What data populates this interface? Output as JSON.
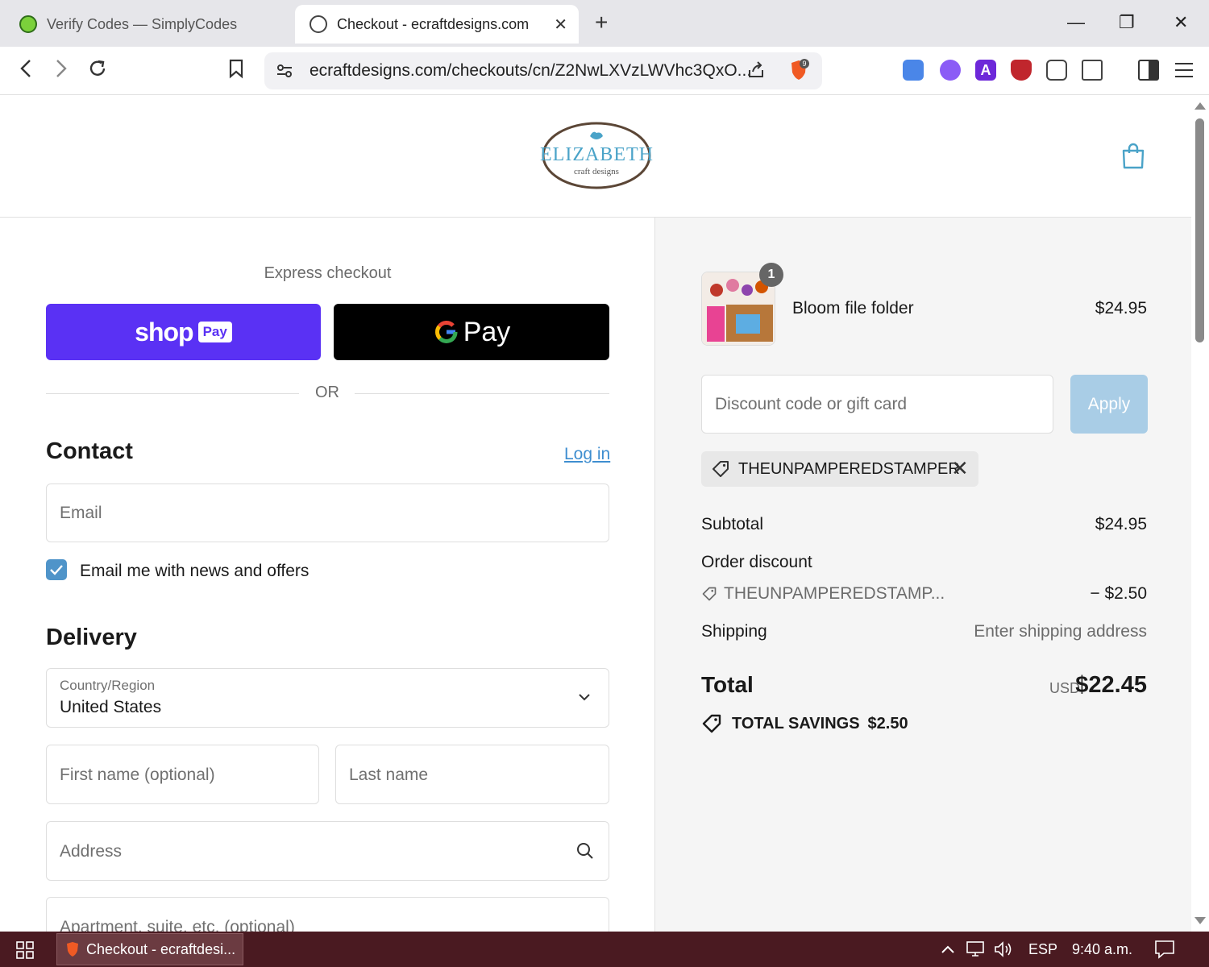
{
  "browser": {
    "tabs": [
      {
        "title": "Verify Codes — SimplyCodes",
        "active": false
      },
      {
        "title": "Checkout - ecraftdesigns.com",
        "active": true
      }
    ],
    "url": "ecraftdesigns.com/checkouts/cn/Z2NwLXVzLWVhc3QxO...",
    "brave_badge": "9"
  },
  "shop": {
    "logo_title": "ELIZABETH",
    "logo_sub": "craft designs"
  },
  "checkout": {
    "express_label": "Express checkout",
    "shoppay_word": "shop",
    "shoppay_chip": "Pay",
    "gpay_label": "Pay",
    "or_label": "OR",
    "contact_title": "Contact",
    "login_label": "Log in",
    "email_placeholder": "Email",
    "newsletter_label": "Email me with news and offers",
    "newsletter_checked": true,
    "delivery_title": "Delivery",
    "country_label": "Country/Region",
    "country_value": "United States",
    "first_name_placeholder": "First name (optional)",
    "last_name_placeholder": "Last name",
    "address_placeholder": "Address",
    "apartment_placeholder": "Apartment, suite, etc. (optional)"
  },
  "summary": {
    "item": {
      "name": "Bloom file folder",
      "price": "$24.95",
      "quantity": "1"
    },
    "discount_placeholder": "Discount code or gift card",
    "apply_label": "Apply",
    "applied_code": "THEUNPAMPEREDSTAMPER",
    "subtotal_label": "Subtotal",
    "subtotal_value": "$24.95",
    "order_discount_label": "Order discount",
    "discount_code_short": "THEUNPAMPEREDSTAMP...",
    "discount_value": "− $2.50",
    "shipping_label": "Shipping",
    "shipping_value": "Enter shipping address",
    "total_label": "Total",
    "total_currency": "USD",
    "total_value": "$22.45",
    "savings_label": "TOTAL SAVINGS",
    "savings_value": "$2.50"
  },
  "taskbar": {
    "task_title": "Checkout - ecraftdesi...",
    "language": "ESP",
    "time": "9:40 a.m."
  },
  "colors": {
    "shoppay": "#5a31f4",
    "link": "#3e8ed0",
    "apply_disabled": "#a9cde6",
    "taskbar": "#4a1a21"
  }
}
